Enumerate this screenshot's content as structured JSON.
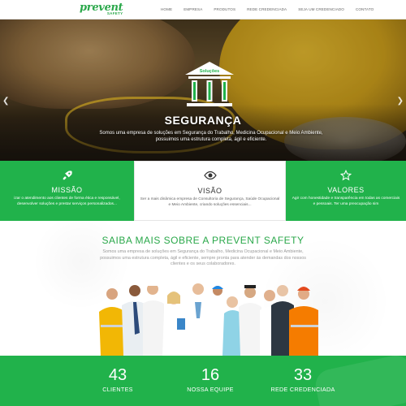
{
  "brand": {
    "name": "prevent",
    "tagline": "SAFETY"
  },
  "nav": {
    "items": [
      "HOME",
      "EMPRESA",
      "PRODUTOS",
      "REDE CREDENCIADA",
      "SEJA UM CREDENCIADO",
      "CONTATO"
    ]
  },
  "hero": {
    "badge": "Soluções",
    "title": "SEGURANÇA",
    "text": "Somos uma empresa de soluções em Segurança do Trabalho, Medicina Ocupacional e Meio Ambiente, possuimos uma estrutura completa, ágil e eficiente.",
    "slides": 3,
    "active_slide": 1,
    "prev_icon": "chevron-left-icon",
    "next_icon": "chevron-right-icon"
  },
  "features": [
    {
      "icon": "rocket-icon",
      "title": "MISSÃO",
      "text": "izar o atendimento aos clientes de forma ética e responsável, desenvolver soluções e prestar serviços personalizados..."
    },
    {
      "icon": "eye-icon",
      "title": "VISÃO",
      "text": "Ser a mais dinâmica empresa de Consultoria de Segurança, Saúde Ocupacional e Meio Ambiente, criando soluções essenciais..."
    },
    {
      "icon": "star-icon",
      "title": "VALORES",
      "text": "Agir com honestidade e transparência em todas as comerciais e pessoais. Ter uma preocupação sim"
    }
  ],
  "about": {
    "title": "SAIBA MAIS SOBRE A PREVENT SAFETY",
    "text": "Somos uma empresa de soluções em Segurança do Trabalho, Medicina Ocupacional e Meio Ambiente, possuimos uma estrutura completa, ágil e eficiente, sempre pronta para atender às demandas dos nossos clientes e os seus colaboradores."
  },
  "stats": [
    {
      "value": "43",
      "label": "CLIENTES"
    },
    {
      "value": "16",
      "label": "NOSSA EQUIPE"
    },
    {
      "value": "33",
      "label": "REDE CREDENCIADA"
    }
  ],
  "colors": {
    "brand_green": "#21b24b",
    "logo_green": "#2aa84a",
    "helmet_yellow": "#f3c630"
  }
}
